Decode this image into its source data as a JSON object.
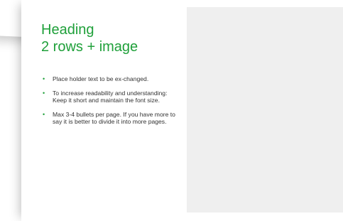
{
  "slide": {
    "heading_line1": "Heading",
    "heading_line2": "2 rows + image",
    "bullets": [
      {
        "text": "Place holder text to be ex-changed."
      },
      {
        "text": "To increase readability and understanding: Keep it short and maintain the font size."
      },
      {
        "text": "Max 3-4 bullets per page. If you have more to say it is better to divide it into more pages."
      }
    ],
    "bullet_symbol": "•"
  },
  "colors": {
    "accent": "#1fa03a",
    "image_placeholder": "#efefef",
    "text": "#333333"
  }
}
